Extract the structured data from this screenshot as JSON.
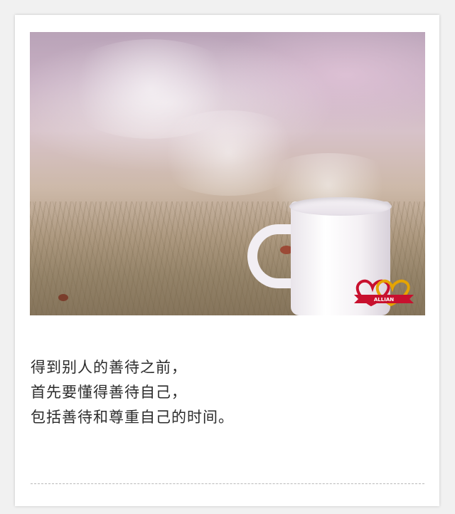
{
  "photo": {
    "description_icon": "coffee-mug-photo",
    "logo_text": "ALLIAN"
  },
  "text": {
    "lines": [
      "得到别人的善待之前，",
      "首先要懂得善待自己，",
      "包括善待和尊重自己的时间。"
    ]
  },
  "colors": {
    "background": "#f1f1f1",
    "card": "#ffffff",
    "text": "#2b2b2b",
    "logo_red": "#c8102e",
    "logo_gold": "#e6a400"
  }
}
